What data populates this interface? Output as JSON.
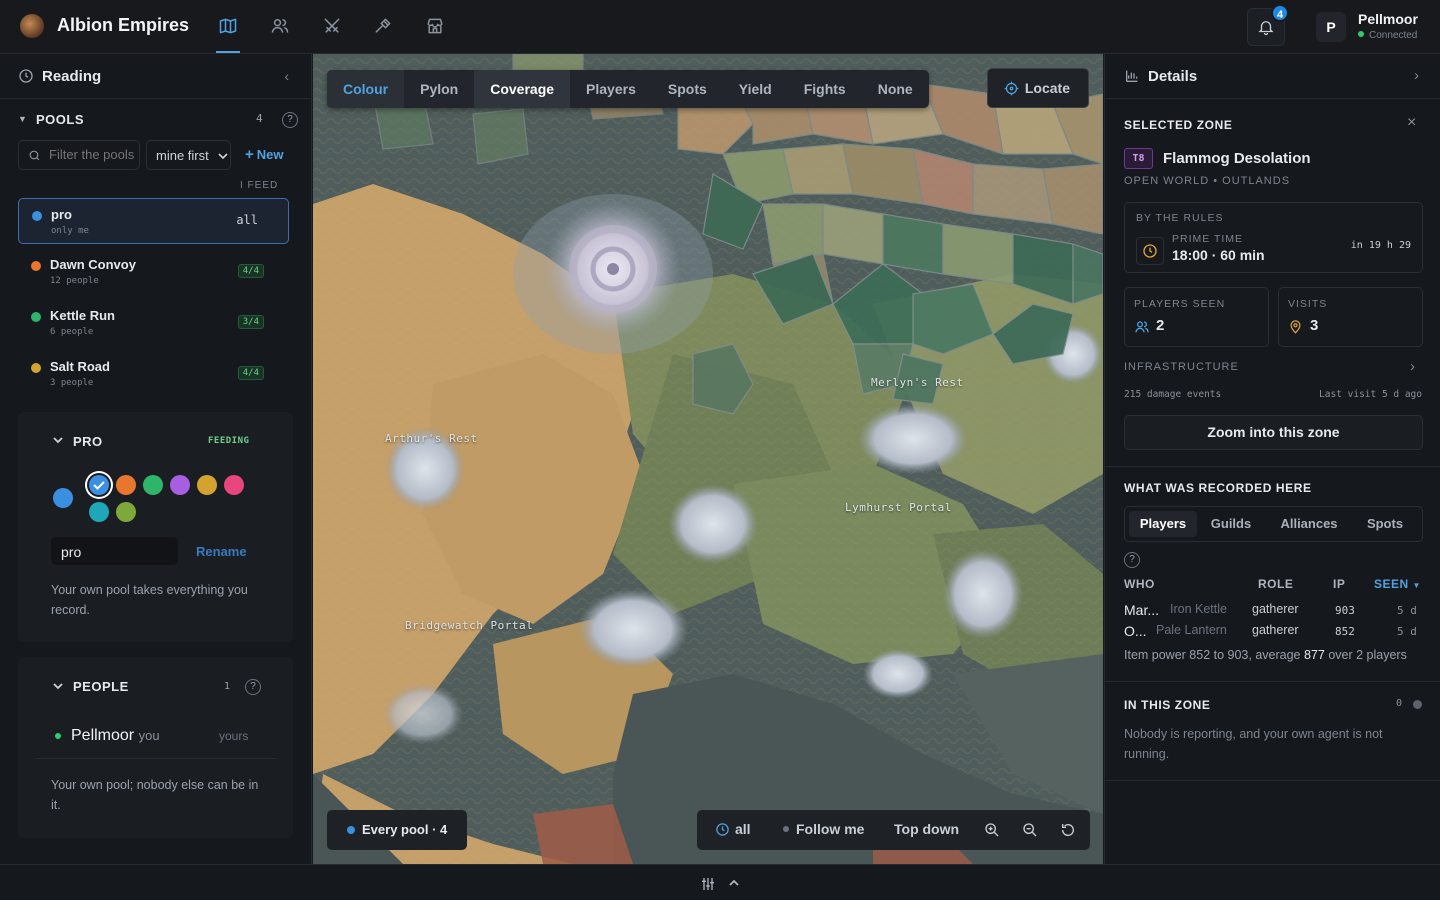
{
  "app": {
    "title": "Albion Empires"
  },
  "nav": {
    "items": [
      {
        "name": "map",
        "active": true
      },
      {
        "name": "people"
      },
      {
        "name": "fights"
      },
      {
        "name": "tools"
      },
      {
        "name": "market"
      }
    ]
  },
  "notifications": {
    "count": "4"
  },
  "user": {
    "initial": "P",
    "name": "Pellmoor",
    "status": "Connected"
  },
  "left": {
    "title": "Reading",
    "pools_header": "POOLS",
    "pools_count": "4",
    "filter_placeholder": "Filter the pools",
    "sort_value": "mine first",
    "new_label": "New",
    "feed_header": "I FEED",
    "pools": [
      {
        "name": "pro",
        "sub": "only me",
        "badge": "all",
        "color": "#3b8fe0"
      },
      {
        "name": "Dawn Convoy",
        "sub": "12 people",
        "badge": "4/4",
        "color": "#e8762d"
      },
      {
        "name": "Kettle Run",
        "sub": "6 people",
        "badge": "3/4",
        "color": "#2fb56a"
      },
      {
        "name": "Salt Road",
        "sub": "3 people",
        "badge": "4/4",
        "color": "#d4a22f"
      }
    ],
    "pro_card": {
      "title": "PRO",
      "status": "FEEDING",
      "current_color": "#3b8fe0",
      "swatches": [
        "#3b8fe0",
        "#e8762d",
        "#2fb56a",
        "#a85ee0",
        "#d4a22f",
        "#e8467c",
        "#1fa6b8",
        "#7fa83a"
      ],
      "name_value": "pro",
      "rename_label": "Rename",
      "note": "Your own pool takes everything you record."
    },
    "people_card": {
      "title": "PEOPLE",
      "count": "1",
      "person_name": "Pellmoor",
      "person_tag": "you",
      "person_role": "yours",
      "note": "Your own pool; nobody else can be in it."
    }
  },
  "map": {
    "modes": [
      "Colour",
      "Pylon",
      "Coverage",
      "Players",
      "Spots",
      "Yield",
      "Fights",
      "None"
    ],
    "active_mode": "Coverage",
    "locate_label": "Locate",
    "labels": [
      "Merlyn's Rest",
      "Arthur's Rest",
      "Lymhurst Portal",
      "Bridgewatch Portal"
    ],
    "pool_filter": "Every pool · 4",
    "time_filter": "all",
    "follow_label": "Follow me",
    "view_label": "Top down"
  },
  "right": {
    "title": "Details",
    "selected_zone_header": "SELECTED ZONE",
    "zone": {
      "tier": "T8",
      "name": "Flammog Desolation",
      "region": "OPEN WORLD • OUTLANDS"
    },
    "rules_label": "BY THE RULES",
    "prime_label": "PRIME TIME",
    "prime_value": "18:00 · 60 min",
    "prime_countdown": "in 19 h 29",
    "players_seen_label": "PLAYERS SEEN",
    "players_seen": "2",
    "visits_label": "VISITS",
    "visits": "3",
    "infra_label": "INFRASTRUCTURE",
    "damage_events": "215 damage events",
    "last_visit": "Last visit 5 d ago",
    "zoom_button": "Zoom into this zone",
    "recorded_header": "WHAT WAS RECORDED HERE",
    "tabs": [
      "Players",
      "Guilds",
      "Alliances",
      "Spots"
    ],
    "table_headers": {
      "who": "WHO",
      "role": "ROLE",
      "ip": "IP",
      "seen": "SEEN"
    },
    "rows": [
      {
        "who": "Mar...",
        "guild": "Iron Kettle",
        "role": "gatherer",
        "ip": "903",
        "seen": "5 d"
      },
      {
        "who": "O...",
        "guild": "Pale Lantern",
        "role": "gatherer",
        "ip": "852",
        "seen": "5 d"
      }
    ],
    "summary_prefix": "Item power 852 to 903, average ",
    "summary_avg": "877",
    "summary_suffix": " over 2 players",
    "in_zone_header": "IN THIS ZONE",
    "in_zone_count": "0",
    "in_zone_text": "Nobody is reporting, and your own agent is not running."
  }
}
